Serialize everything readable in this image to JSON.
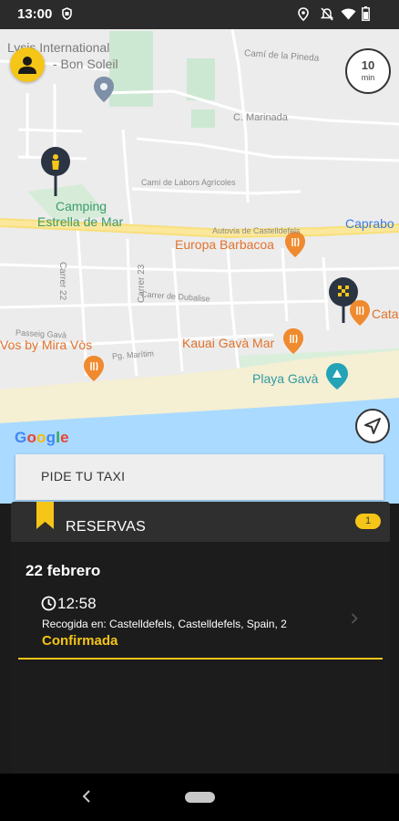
{
  "status_bar": {
    "time": "13:00"
  },
  "map": {
    "labels": {
      "hotel_line1": "Lysis International",
      "hotel_line2": "- Bon Soleil",
      "cami_pineda": "Camí de la Pineda",
      "c_marinada": "C. Marinada",
      "cami_labors": "Camí de Labors Agrícoles",
      "camping_line1": "Camping",
      "camping_line2": "Estrella de Mar",
      "autovia": "Autovia de Castelldefels",
      "caprabo": "Caprabo",
      "europa": "Europa Barbacoa",
      "carrer22": "Carrer 22",
      "carrer23": "Carrer 23",
      "carrer_dubalise": "Carrer de Dubalise",
      "cata": "Cata",
      "passeig": "Passeig Gavà",
      "vos": "Vos by Mira Vòs",
      "maritim": "Pg. Marítim",
      "kauai": "Kauai Gavà Mar",
      "playa": "Playa Gavà",
      "google": "Google"
    },
    "eta_value": "10",
    "eta_unit": "min"
  },
  "pide_taxi": {
    "label": "PIDE TU TAXI"
  },
  "reservas": {
    "title": "RESERVAS",
    "count": "1",
    "date": "22 febrero",
    "item": {
      "time": "12:58",
      "pickup": "Recogida en: Castelldefels, Castelldefels, Spain, 2",
      "status": "Confirmada"
    }
  },
  "colors": {
    "accent": "#f5c518",
    "panel_bg": "#1c1c1c",
    "panel_header": "#2f2f2f",
    "map_bg": "#ececec",
    "water": "#aadaff"
  }
}
